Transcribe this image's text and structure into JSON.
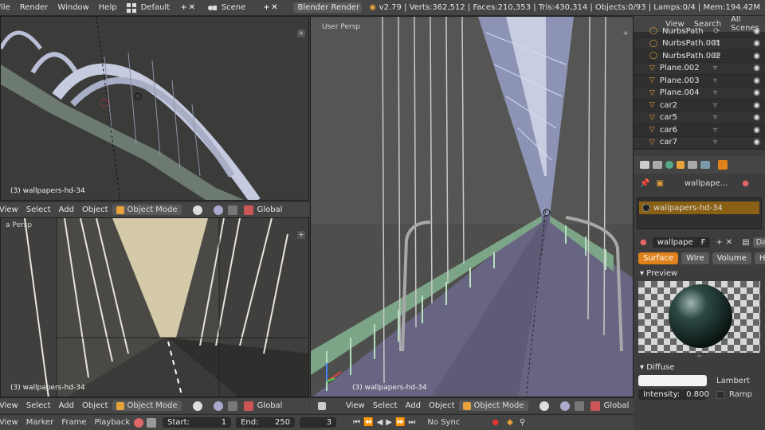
{
  "topbar": {
    "menus": [
      "File",
      "Render",
      "Window",
      "Help"
    ],
    "layout": "Default",
    "scene": "Scene",
    "engine": "Blender Render",
    "stats": "v2.79 | Verts:362,512 | Faces:210,353 | Tris:430,314 | Objects:0/93 | Lamps:0/4 | Mem:194.42M"
  },
  "viewport_top_left": {
    "label": "",
    "object": "(3) wallpapers-hd-34"
  },
  "viewport_bottom_left": {
    "label": "a Persp",
    "object": "(3) wallpapers-hd-34"
  },
  "viewport_main": {
    "label": "User Persp",
    "object": "(3) wallpapers-hd-34"
  },
  "header_top_left": {
    "items": [
      "View",
      "Select",
      "Add",
      "Object"
    ],
    "mode": "Object Mode",
    "orientation": "Global"
  },
  "header_bottom_left": {
    "items": [
      "View",
      "Select",
      "Add",
      "Object"
    ],
    "mode": "Object Mode",
    "orientation": "Global"
  },
  "header_main": {
    "items": [
      "View",
      "Select",
      "Add",
      "Object"
    ],
    "mode": "Object Mode",
    "orientation": "Global"
  },
  "timeline": {
    "items": [
      "View",
      "Marker",
      "Frame",
      "Playback"
    ],
    "start_label": "Start:",
    "start": "1",
    "end_label": "End:",
    "end": "250",
    "current": "3",
    "sync": "No Sync"
  },
  "outliner": {
    "tabs": [
      "View",
      "Search",
      "All Scenes"
    ],
    "rows": [
      {
        "name": "NurbsPath",
        "type": "curve"
      },
      {
        "name": "NurbsPath.001",
        "type": "curve"
      },
      {
        "name": "NurbsPath.002",
        "type": "curve"
      },
      {
        "name": "Plane.002",
        "type": "mesh"
      },
      {
        "name": "Plane.003",
        "type": "mesh"
      },
      {
        "name": "Plane.004",
        "type": "mesh"
      },
      {
        "name": "car2",
        "type": "mesh"
      },
      {
        "name": "car5",
        "type": "mesh"
      },
      {
        "name": "car6",
        "type": "mesh"
      },
      {
        "name": "car7",
        "type": "mesh"
      }
    ]
  },
  "properties": {
    "breadcrumb": "wallpape...",
    "material_slot": "wallpapers-hd-34",
    "material_name": "wallpape",
    "material_f": "F",
    "data_label": "Da",
    "tabs": [
      "Surface",
      "Wire",
      "Volume",
      "Ha"
    ],
    "preview_label": "Preview",
    "diffuse_label": "Diffuse",
    "shader": "Lambert",
    "intensity_label": "Intensity:",
    "intensity": "0.800",
    "ramp": "Ramp",
    "colors": {
      "accent": "#e0821c",
      "selection": "#8a6014"
    }
  }
}
